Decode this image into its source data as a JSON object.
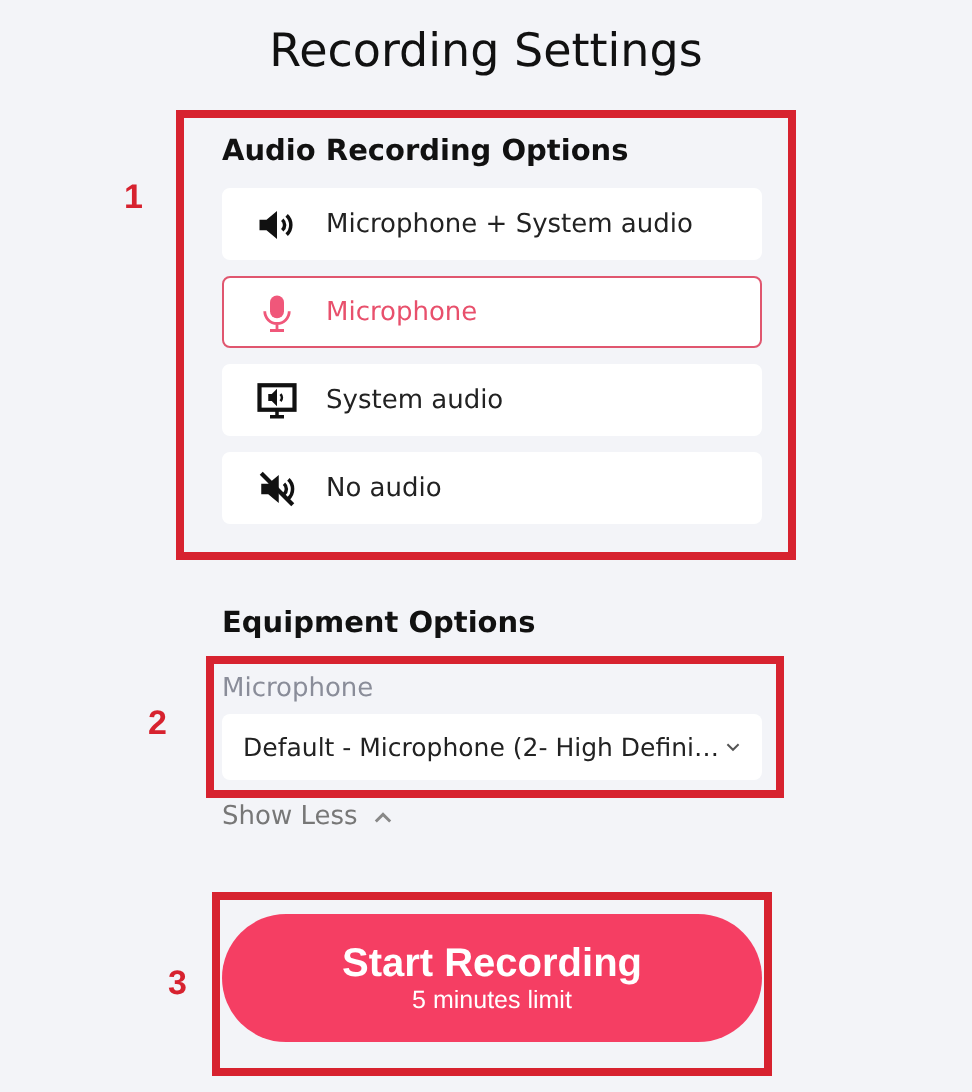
{
  "title": "Recording Settings",
  "audio_section": {
    "annotation": "1",
    "heading": "Audio Recording Options",
    "options": [
      {
        "kind": "speaker",
        "label": "Microphone + System audio",
        "selected": false
      },
      {
        "kind": "mic",
        "label": "Microphone",
        "selected": true
      },
      {
        "kind": "monitor",
        "label": "System audio",
        "selected": false
      },
      {
        "kind": "muted",
        "label": "No audio",
        "selected": false
      }
    ]
  },
  "equipment_section": {
    "heading": "Equipment Options",
    "annotation": "2",
    "field_label": "Microphone",
    "value": "Default - Microphone (2- High Defini…",
    "toggle": "Show Less"
  },
  "start_section": {
    "annotation": "3",
    "button": "Start Recording",
    "subtitle": "5 minutes limit"
  }
}
